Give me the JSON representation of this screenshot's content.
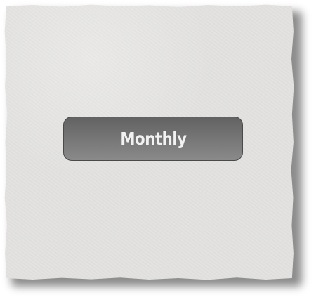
{
  "button": {
    "label": "Monthly"
  },
  "colors": {
    "paper": "#e3e2e0",
    "button_top": "#626262",
    "button_bottom": "#8a8a8a",
    "button_text": "#f2f2f2"
  }
}
